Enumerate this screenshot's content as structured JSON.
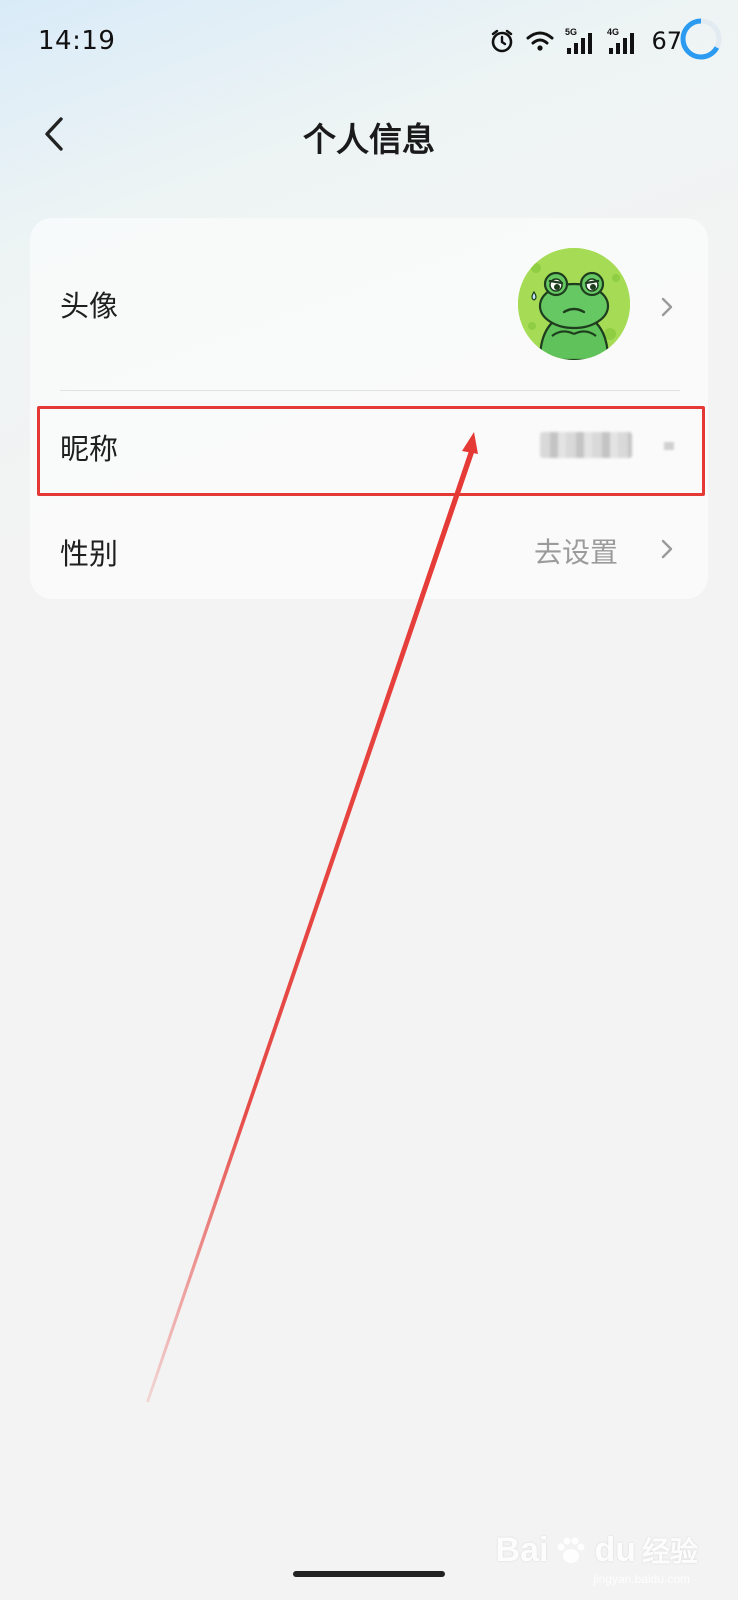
{
  "status_bar": {
    "time": "14:19",
    "signal_1_label": "5G",
    "signal_2_label": "4G",
    "battery": "67",
    "icons": [
      "alarm-icon",
      "wifi-icon",
      "signal-5g-icon",
      "signal-4g-icon",
      "battery-ring-icon"
    ]
  },
  "header": {
    "title": "个人信息",
    "back_icon": "chevron-left-icon"
  },
  "profile": {
    "avatar_label": "头像",
    "nickname_label": "昵称",
    "nickname_value": "",
    "gender_label": "性别",
    "gender_value": "去设置"
  },
  "annotation": {
    "highlight_color": "#e53935"
  },
  "watermark": {
    "brand": "Bai",
    "brand_end": "du",
    "jingyan": "经验",
    "sub": "jingyan.baidu.com"
  }
}
